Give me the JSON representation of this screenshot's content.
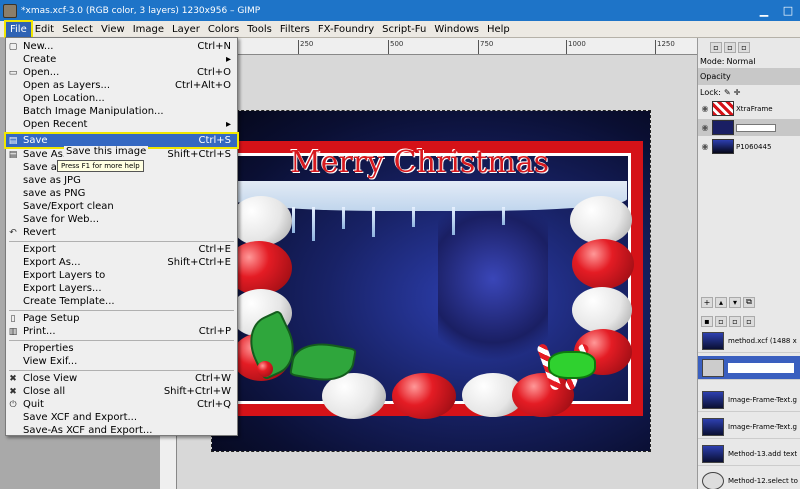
{
  "window": {
    "title": "*xmas.xcf-3.0 (RGB color, 3 layers) 1230x956 – GIMP",
    "minimize": "▁",
    "maximize": "□"
  },
  "menubar": {
    "items": [
      "File",
      "Edit",
      "Select",
      "View",
      "Image",
      "Layer",
      "Colors",
      "Tools",
      "Filters",
      "FX-Foundry",
      "Script-Fu",
      "Windows",
      "Help"
    ],
    "active": "File"
  },
  "ruler": {
    "labels": [
      "250",
      "500",
      "750",
      "1000",
      "1250"
    ]
  },
  "image": {
    "title": "Merry Christmas"
  },
  "file_menu": {
    "items": [
      {
        "label": "New...",
        "shortcut": "Ctrl+N",
        "icon": "new-icon"
      },
      {
        "label": "Create",
        "shortcut": "▸",
        "icon": ""
      },
      {
        "label": "Open...",
        "shortcut": "Ctrl+O",
        "icon": "open-icon"
      },
      {
        "label": "Open as Layers...",
        "shortcut": "Ctrl+Alt+O",
        "icon": ""
      },
      {
        "label": "Open Location...",
        "shortcut": "",
        "icon": ""
      },
      {
        "label": "Batch Image Manipulation...",
        "shortcut": "",
        "icon": ""
      },
      {
        "label": "Open Recent",
        "shortcut": "▸",
        "icon": ""
      },
      {
        "label": "Save",
        "shortcut": "Ctrl+S",
        "icon": "save-icon"
      },
      {
        "label": "Save As...",
        "shortcut": "Shift+Ctrl+S",
        "icon": "save-as-icon"
      },
      {
        "label": "Save a Copy...",
        "shortcut": "",
        "icon": ""
      },
      {
        "label": "save as JPG",
        "shortcut": "",
        "icon": ""
      },
      {
        "label": "save as PNG",
        "shortcut": "",
        "icon": ""
      },
      {
        "label": "Save/Export clean",
        "shortcut": "",
        "icon": ""
      },
      {
        "label": "Save for Web...",
        "shortcut": "",
        "icon": ""
      },
      {
        "label": "Revert",
        "shortcut": "",
        "icon": "revert-icon"
      },
      {
        "label": "Export",
        "shortcut": "Ctrl+E",
        "icon": ""
      },
      {
        "label": "Export As...",
        "shortcut": "Shift+Ctrl+E",
        "icon": ""
      },
      {
        "label": "Export Layers to",
        "shortcut": "",
        "icon": ""
      },
      {
        "label": "Export Layers...",
        "shortcut": "",
        "icon": ""
      },
      {
        "label": "Create Template...",
        "shortcut": "",
        "icon": ""
      },
      {
        "label": "Page Setup",
        "shortcut": "",
        "icon": "page-setup-icon"
      },
      {
        "label": "Print...",
        "shortcut": "Ctrl+P",
        "icon": "print-icon"
      },
      {
        "label": "Properties",
        "shortcut": "",
        "icon": ""
      },
      {
        "label": "View Exif...",
        "shortcut": "",
        "icon": ""
      },
      {
        "label": "Close View",
        "shortcut": "Ctrl+W",
        "icon": "close-icon"
      },
      {
        "label": "Close all",
        "shortcut": "Shift+Ctrl+W",
        "icon": "close-all-icon"
      },
      {
        "label": "Quit",
        "shortcut": "Ctrl+Q",
        "icon": "quit-icon"
      },
      {
        "label": "Save XCF and Export...",
        "shortcut": "",
        "icon": ""
      },
      {
        "label": "Save-As XCF and Export...",
        "shortcut": "",
        "icon": ""
      }
    ],
    "highlighted": "Save"
  },
  "tooltip": {
    "title": "Save this image",
    "hint": "Press F1 for more help"
  },
  "right_panel": {
    "mode_label": "Mode:",
    "mode_value": "Normal",
    "opacity_label": "Opacity",
    "lock_label": "Lock:",
    "layers": [
      {
        "name": "XtraFrame",
        "visible": true
      },
      {
        "name": "",
        "visible": true
      },
      {
        "name": "P1060445",
        "visible": true
      }
    ],
    "history": [
      {
        "name": "method.xcf (1488 x"
      },
      {
        "name": ""
      },
      {
        "name": "Image-Frame-Text.g"
      },
      {
        "name": "Image-Frame-Text.g"
      },
      {
        "name": "Method-13.add text"
      },
      {
        "name": "Method-12.select to"
      }
    ]
  }
}
